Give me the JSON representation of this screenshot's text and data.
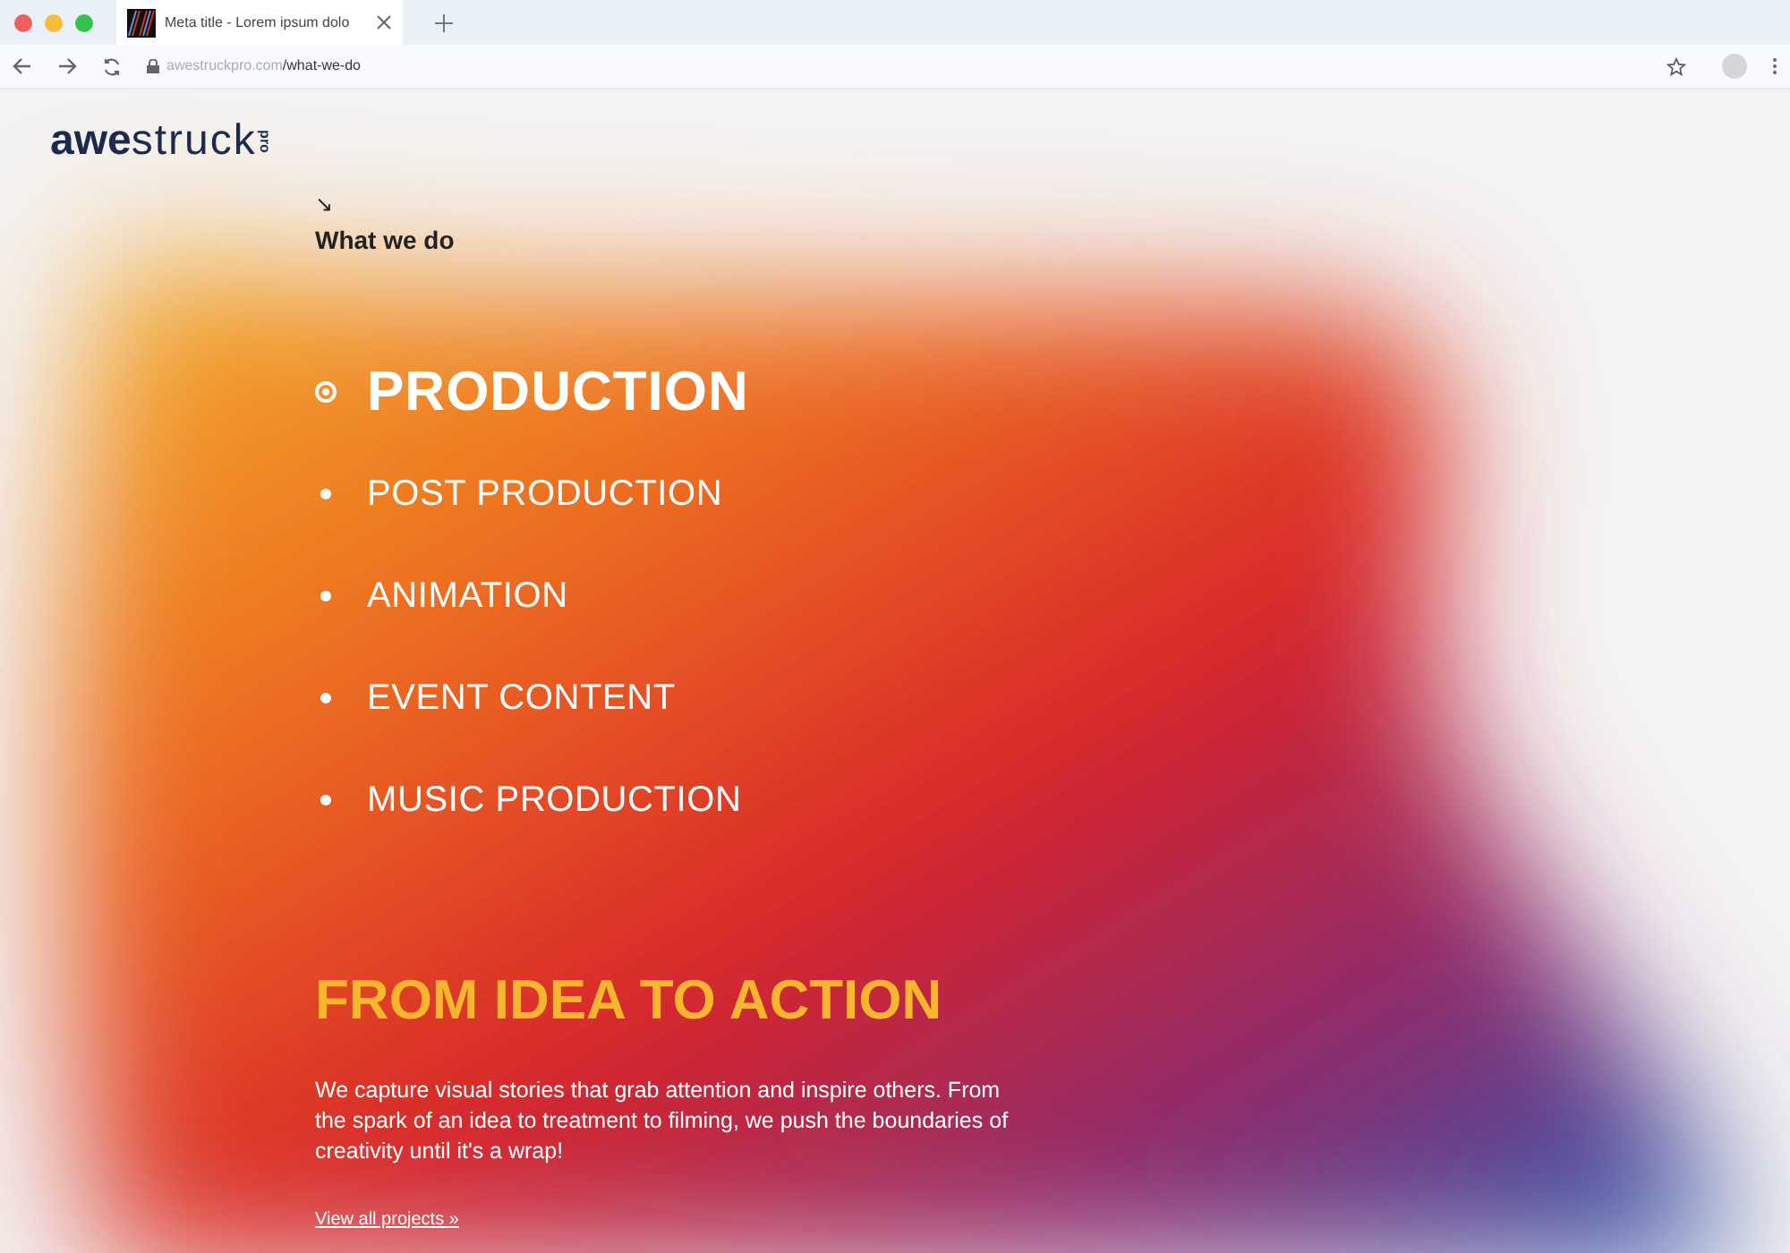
{
  "browser": {
    "tab_title": "Meta title - Lorem ipsum dolo",
    "url_host": "awestruckpro.com",
    "url_path": "/what-we-do"
  },
  "logo": {
    "bold": "awe",
    "light": "struck",
    "suffix": "pro"
  },
  "section_arrow": "↘",
  "section_label": "What we do",
  "services": [
    {
      "label": "PRODUCTION",
      "selected": true
    },
    {
      "label": "POST PRODUCTION",
      "selected": false
    },
    {
      "label": "ANIMATION",
      "selected": false
    },
    {
      "label": "EVENT CONTENT",
      "selected": false
    },
    {
      "label": "MUSIC PRODUCTION",
      "selected": false
    }
  ],
  "headline": "FROM IDEA TO ACTION",
  "body": "We capture visual stories that grab attention and inspire others. From the spark of an idea to treatment to filming, we push the boundaries of creativity until it's a wrap!",
  "link": "View all projects »"
}
